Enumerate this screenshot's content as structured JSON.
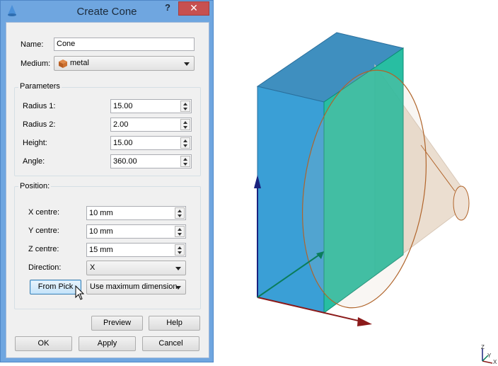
{
  "window": {
    "title": "Create Cone",
    "help_glyph": "?",
    "close_glyph": "✕"
  },
  "name": {
    "label": "Name:",
    "value": "Cone"
  },
  "medium": {
    "label": "Medium:",
    "value": "metal",
    "icon": "metal-cube-icon"
  },
  "parameters": {
    "title": "Parameters",
    "fields": [
      {
        "label": "Radius 1:",
        "value": "15.00"
      },
      {
        "label": "Radius 2:",
        "value": "2.00"
      },
      {
        "label": "Height:",
        "value": "15.00"
      },
      {
        "label": "Angle:",
        "value": "360.00"
      }
    ]
  },
  "position": {
    "title": "Position:",
    "fields": [
      {
        "label": "X centre:",
        "value": "10 mm"
      },
      {
        "label": "Y centre:",
        "value": "10 mm"
      },
      {
        "label": "Z centre:",
        "value": "15 mm"
      }
    ],
    "direction": {
      "label": "Direction:",
      "value": "X"
    },
    "from_pick_label": "From Pick",
    "dimension_option": "Use maximum dimension"
  },
  "buttons": {
    "preview": "Preview",
    "help": "Help",
    "ok": "OK",
    "apply": "Apply",
    "cancel": "Cancel"
  },
  "triad": {
    "z": "Z",
    "y": "Y",
    "x": "X"
  },
  "colors": {
    "title_bar": "#6fa6e0",
    "close_button": "#c75050",
    "box_front": "#3a9fd6",
    "box_side": "#16b89a",
    "cone_fill": "#e8d8c8",
    "cone_outline": "#b0642a",
    "axis_z": "#1a237e",
    "axis_x": "#8b1a1a"
  }
}
